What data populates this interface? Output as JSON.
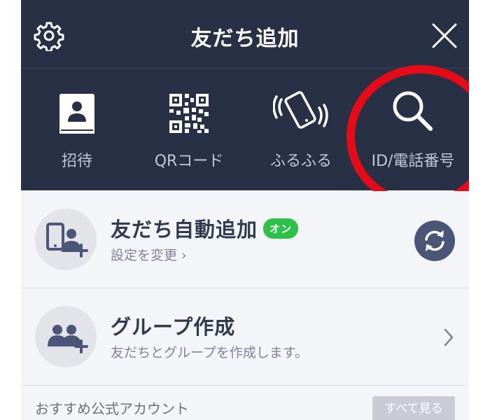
{
  "header": {
    "title": "友だち追加",
    "settings_icon": "gear-icon",
    "close_icon": "close-icon"
  },
  "methods": [
    {
      "label": "招待",
      "icon": "contacts-book-icon"
    },
    {
      "label": "QRコード",
      "icon": "qr-code-icon"
    },
    {
      "label": "ふるふる",
      "icon": "shake-phone-icon"
    },
    {
      "label": "ID/電話番号",
      "icon": "search-icon"
    }
  ],
  "auto_add": {
    "title": "友だち自動追加",
    "badge": "オン",
    "subtitle": "設定を変更 ›",
    "icon": "phone-person-plus-icon",
    "action_icon": "refresh-icon"
  },
  "group": {
    "title": "グループ作成",
    "subtitle": "友だちとグループを作成します。",
    "icon": "group-plus-icon"
  },
  "recommended": {
    "title": "おすすめ公式アカウント",
    "see_all": "すべて見る"
  },
  "colors": {
    "header_bg": "#283046",
    "highlight_ring": "#e30c18",
    "badge_green": "#2dc04a"
  }
}
